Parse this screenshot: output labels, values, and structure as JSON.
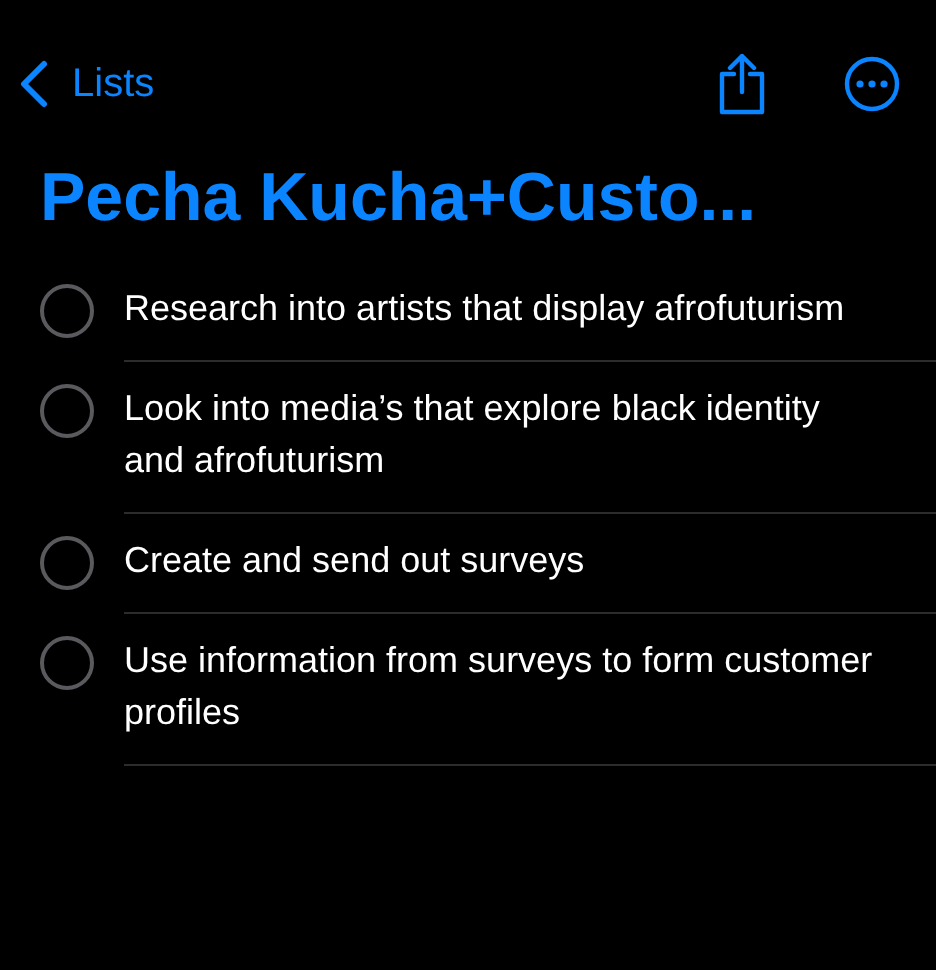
{
  "nav": {
    "back_label": "Lists"
  },
  "title": "Pecha Kucha+Custo...",
  "reminders": [
    {
      "text": "Research into artists that display afrofuturism",
      "checked": false
    },
    {
      "text": "Look into media’s that explore black identity and afrofuturism",
      "checked": false
    },
    {
      "text": "Create and send out surveys",
      "checked": false
    },
    {
      "text": "Use information from surveys to form customer profiles",
      "checked": false
    }
  ]
}
